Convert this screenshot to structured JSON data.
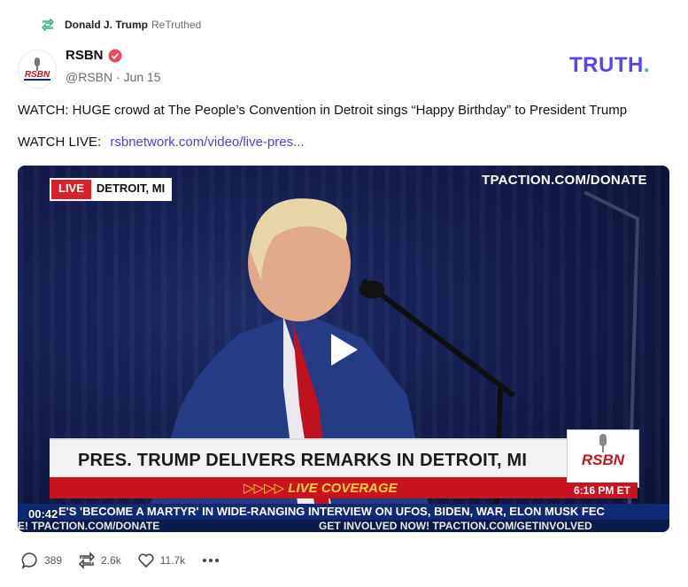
{
  "retruth": {
    "name": "Donald J. Trump",
    "tag": "ReTruthed"
  },
  "author": {
    "name": "RSBN",
    "handle": "@RSBN",
    "separator": "·",
    "date": "Jun 15"
  },
  "brand": {
    "logo_main": "TRUTH",
    "logo_dot": "."
  },
  "post": {
    "text": "WATCH: HUGE crowd at The People’s Convention in Detroit sings “Happy Birthday” to President Trump",
    "watch_label": "WATCH LIVE:",
    "link": "rsbnetwork.com/video/live-pres..."
  },
  "video": {
    "live_label": "LIVE",
    "location": "DETROIT, MI",
    "top_right": "TPACTION.COM/DONATE",
    "headline": "PRES. TRUMP DELIVERS REMARKS IN DETROIT, MI",
    "live_coverage": "▷▷▷▷ LIVE COVERAGE",
    "rsbn": "RSBN",
    "time": "6:16 PM ET",
    "ticker": "E'S 'BECOME A MARTYR' IN WIDE-RANGING INTERVIEW ON UFOS, BIDEN, WAR, ELON MUSK     FEC",
    "ticker2_left": "E! TPACTION.COM/DONATE",
    "ticker2_right": "GET INVOLVED NOW! TPACTION.COM/GETINVOLVED",
    "timecode": "00:42"
  },
  "actions": {
    "replies": "389",
    "retruths": "2.6k",
    "likes": "11.7k"
  },
  "colors": {
    "accent": "#5448ee",
    "link": "#4a3fe0",
    "verified": "#e84a5f",
    "news_red": "#c8141f",
    "news_blue": "#0f2a74"
  }
}
